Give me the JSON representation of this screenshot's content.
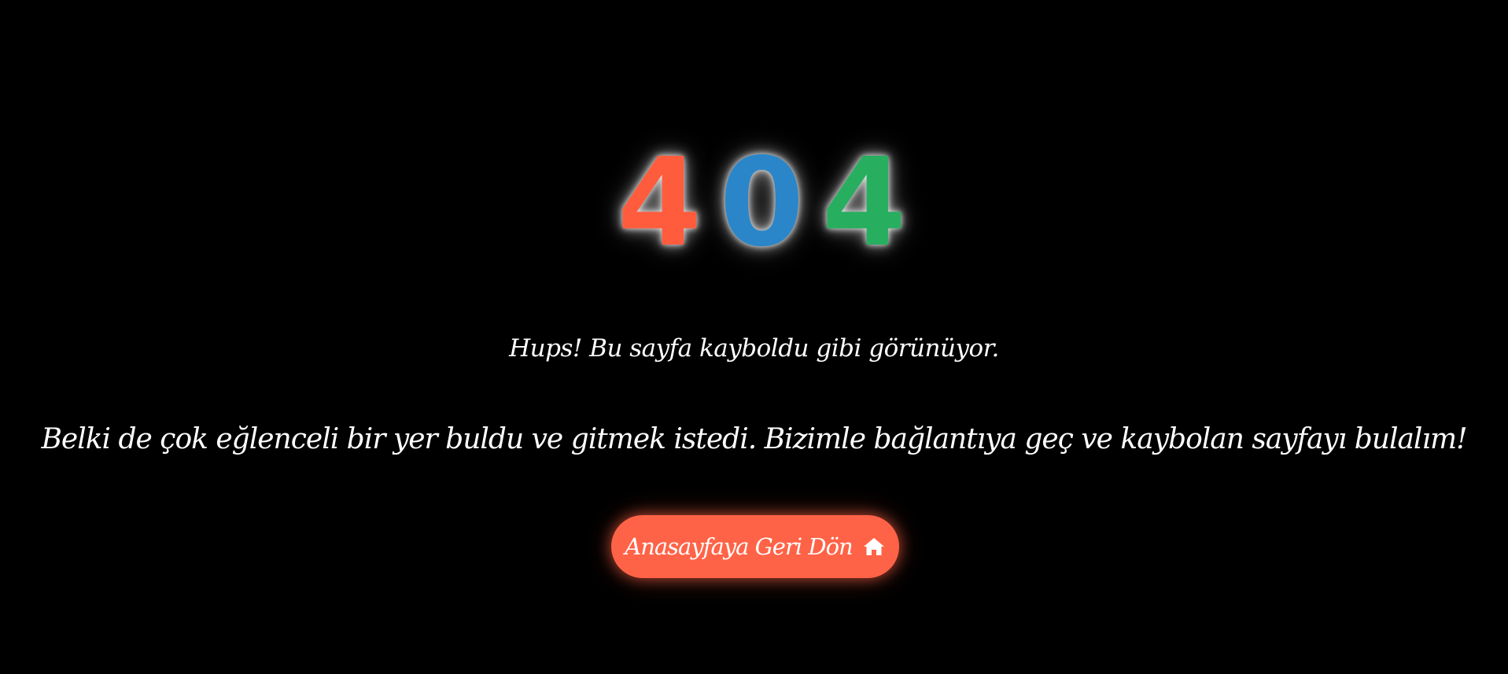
{
  "error": {
    "digits": [
      {
        "char": "4",
        "color": "#ff5c3e"
      },
      {
        "char": "0",
        "color": "#2a86c9"
      },
      {
        "char": "4",
        "color": "#27ae5f"
      }
    ]
  },
  "subtitle": "Hups! Bu sayfa kayboldu gibi görünüyor.",
  "message": "Belki de çok eğlenceli bir yer buldu ve gitmek istedi. Bizimle bağlantıya geç ve kaybolan sayfayı bulalım!",
  "home_button": {
    "label": "Anasayfaya Geri Dön",
    "icon": "home-icon",
    "color": "#ff6347"
  },
  "colors": {
    "background": "#000000",
    "text": "#ffffff"
  }
}
